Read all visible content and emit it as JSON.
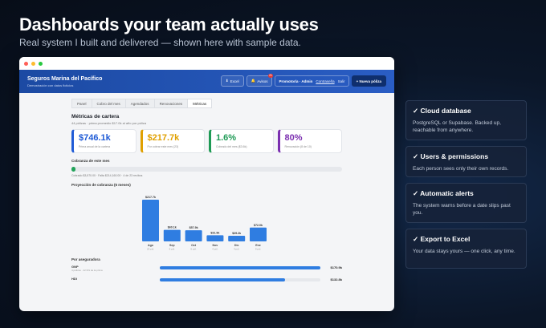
{
  "hero": {
    "title": "Dashboards your team actually uses",
    "subtitle": "Real system I built and delivered — shown here with sample data."
  },
  "window": {
    "dots": [
      "#ff5f57",
      "#febc2e",
      "#28c840"
    ]
  },
  "app": {
    "brand_name": "Seguros Marina del Pacífico",
    "brand_sub": "Demostración con datos ficticios",
    "excel_label": "Excel",
    "alerts_label": "Avisos",
    "alerts_count": "21",
    "user_label": "Promotoría · Admin",
    "password_label": "Contraseña",
    "logout_label": "Salir",
    "new_policy_label": "+ Nueva póliza",
    "tabs": [
      {
        "label": "Panel",
        "active": false
      },
      {
        "label": "Cobro del mes",
        "active": false
      },
      {
        "label": "Agendados",
        "active": false
      },
      {
        "label": "Renovaciones",
        "active": false
      },
      {
        "label": "Métricas",
        "active": true
      }
    ],
    "section_title": "Métricas de cartera",
    "section_sub": "44 pólizas · prima promedio $17.0k al año por póliza",
    "kpis": [
      {
        "value": "$746.1k",
        "label": "Prima anual de la cartera",
        "color": "#1f5bd6"
      },
      {
        "value": "$217.7k",
        "label": "Por cobrar este mes (23)",
        "color": "#e0a000"
      },
      {
        "value": "1.6%",
        "label": "Cobrado del mes ($3.6k)",
        "color": "#1e9a55"
      },
      {
        "value": "80%",
        "label": "Renovación (8 de 10)",
        "color": "#7b2fb0"
      }
    ],
    "collection_title": "Cobranza de este mes",
    "collection_progress": 0.016,
    "collection_color": "#22a35a",
    "collection_note": "Cobrado $3,570.00 · Falta $214,160.00 · 4 de 23 recibos",
    "projection_title": "Proyección de cobranza (6 meses)",
    "insurer_title": "Por aseguradora",
    "insurers": [
      {
        "name": "GNP",
        "sub": "4 pólizas · 22.9% de la prima",
        "fraction": 1.0,
        "value": "$170.9k"
      },
      {
        "name": "HDI",
        "sub": "",
        "fraction": 0.78,
        "value": "$132.8k"
      }
    ]
  },
  "chart_data": {
    "type": "bar",
    "title": "Proyección de cobranza (6 meses)",
    "categories": [
      "Ago",
      "Sep",
      "Oct",
      "Nov",
      "Dic",
      "Ene"
    ],
    "category_sub": [
      "23 pól.",
      "6 pól.",
      "6 pól.",
      "4 pól.",
      "4 pól.",
      "9 pól."
    ],
    "values": [
      217.7,
      60.1,
      57.9,
      31.9,
      29.2,
      72.0
    ],
    "value_labels": [
      "$217.7k",
      "$60.1k",
      "$57.9k",
      "$31.9k",
      "$29.2k",
      "$72.0k"
    ],
    "ylim": [
      0,
      217.7
    ],
    "color": "#2f7de1",
    "grid": false
  },
  "features": [
    {
      "title": "✓ Cloud database",
      "desc": "PostgreSQL or Supabase. Backed up, reachable from anywhere."
    },
    {
      "title": "✓ Users & permissions",
      "desc": "Each person sees only their own records."
    },
    {
      "title": "✓ Automatic alerts",
      "desc": "The system warns before a date slips past you."
    },
    {
      "title": "✓ Export to Excel",
      "desc": "Your data stays yours — one click, any time."
    }
  ]
}
